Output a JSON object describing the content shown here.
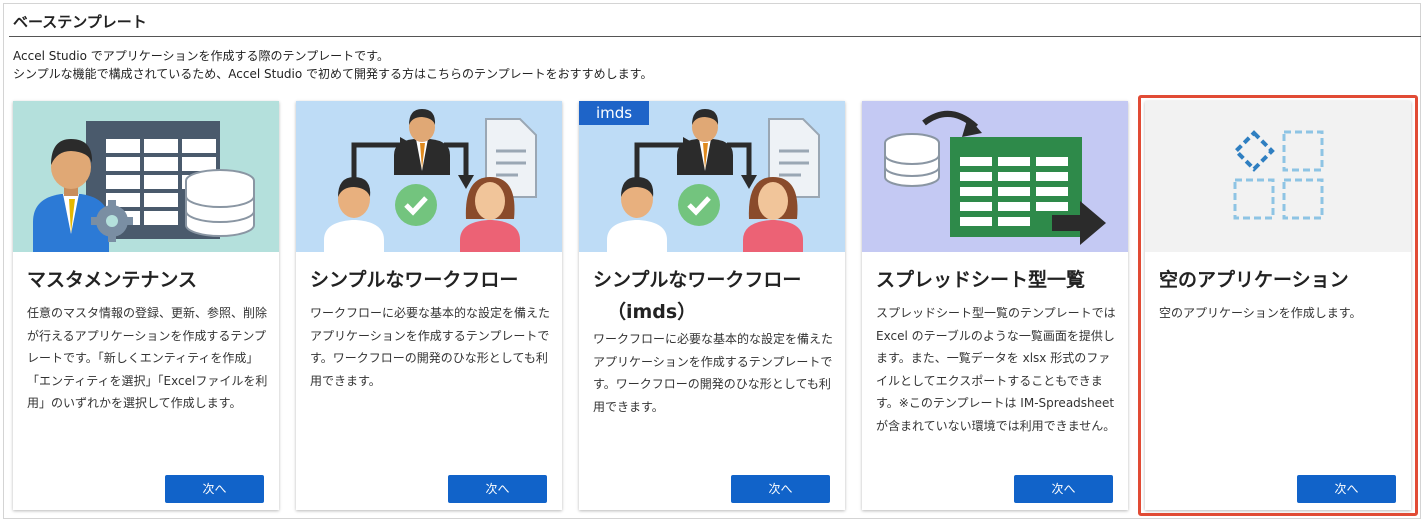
{
  "section": {
    "title": "ベーステンプレート",
    "description_line1": "Accel Studio でアプリケーションを作成する際のテンプレートです。",
    "description_line2": "シンプルな機能で構成されているため、Accel Studio で初めて開発する方はこちらのテンプレートをおすすめします。"
  },
  "colors": {
    "button": "#1163c9",
    "badge": "#1e64c8",
    "highlight_border": "#e14b35"
  },
  "cards": [
    {
      "image": "master-maintenance-illustration",
      "title": "マスタメンテナンス",
      "title_line2": "",
      "badge": "",
      "body": "任意のマスタ情報の登録、更新、参照、削除が行えるアプリケーションを作成するテンプレートです。「新しくエンティティを作成」「エンティティを選択」「Excelファイルを利用」のいずれかを選択して作成します。",
      "button": "次へ"
    },
    {
      "image": "workflow-illustration",
      "title": "シンプルなワークフロー",
      "title_line2": "",
      "badge": "",
      "body": "ワークフローに必要な基本的な設定を備えたアプリケーションを作成するテンプレートです。ワークフローの開発のひな形としても利用できます。",
      "button": "次へ"
    },
    {
      "image": "workflow-imds-illustration",
      "title": "シンプルなワークフロー",
      "title_line2": "（imds）",
      "badge": "imds",
      "body": "ワークフローに必要な基本的な設定を備えたアプリケーションを作成するテンプレートです。ワークフローの開発のひな形としても利用できます。",
      "button": "次へ"
    },
    {
      "image": "spreadsheet-illustration",
      "title": "スプレッドシート型一覧",
      "title_line2": "",
      "badge": "",
      "body": "スプレッドシート型一覧のテンプレートでは Excel のテーブルのような一覧画面を提供します。また、一覧データを xlsx 形式のファイルとしてエクスポートすることもできます。※このテンプレートは IM-Spreadsheet が含まれていない環境では利用できません。",
      "button": "次へ"
    },
    {
      "image": "empty-app-illustration",
      "title": "空のアプリケーション",
      "title_line2": "",
      "badge": "",
      "body": "空のアプリケーションを作成します。",
      "button": "次へ"
    }
  ]
}
